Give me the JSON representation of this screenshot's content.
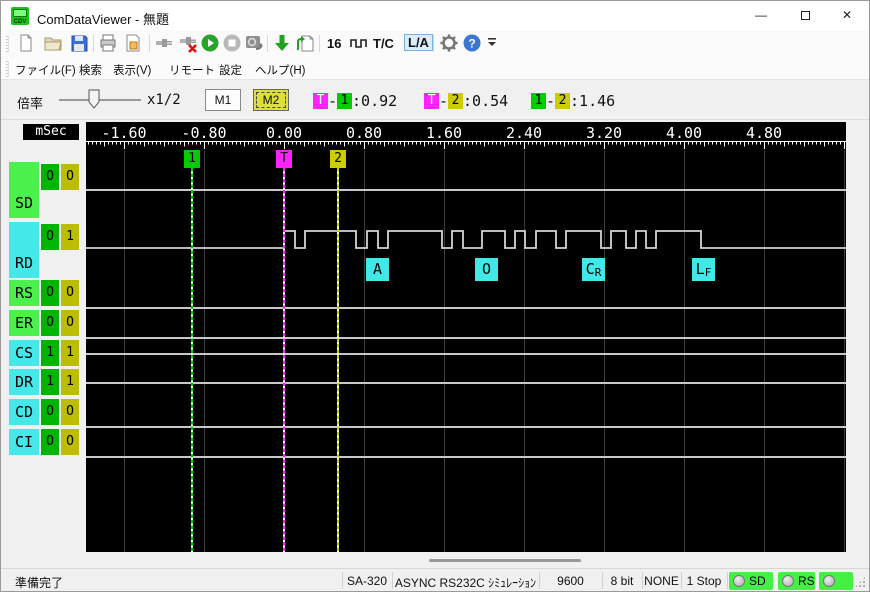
{
  "window": {
    "title": "ComDataViewer - 無題",
    "icon_text": "CDV"
  },
  "toolbar": {
    "icons": [
      "new-file",
      "open-file",
      "save-file",
      "print",
      "print-preview",
      "connect",
      "disconnect",
      "start",
      "stop",
      "capture",
      "download",
      "load-data",
      "gear",
      "help"
    ],
    "text_items": {
      "bits": "16",
      "tc": "T/C",
      "la": "L/A"
    }
  },
  "menu": {
    "items": [
      "ファイル(F)",
      "検索",
      "表示(V)",
      "リモート",
      "設定",
      "ヘルプ(H)"
    ]
  },
  "zoombar": {
    "label": "倍率",
    "scale": "x1/2",
    "m1": "M1",
    "m2": "M2",
    "measurements": [
      {
        "a": "T",
        "a_color": "#ff22ff",
        "a_text": "#fff",
        "b": "1",
        "b_color": "#00cc00",
        "b_text": "#000",
        "value": "0.92"
      },
      {
        "a": "T",
        "a_color": "#ff22ff",
        "a_text": "#fff",
        "b": "2",
        "b_color": "#cccc00",
        "b_text": "#000",
        "value": "0.54"
      },
      {
        "a": "1",
        "a_color": "#00cc00",
        "a_text": "#000",
        "b": "2",
        "b_color": "#cccc00",
        "b_text": "#000",
        "value": "1.46"
      }
    ]
  },
  "ruler": {
    "unit": "mSec",
    "tick_labels": [
      "-1.60",
      "-0.80",
      "0.00",
      "0.80",
      "1.60",
      "2.40",
      "3.20",
      "4.00",
      "4.80"
    ],
    "start_ms": -1.6,
    "step_ms": 0.8
  },
  "markers": [
    {
      "label": "1",
      "ms": -0.92,
      "color": "#00cc00"
    },
    {
      "label": "T",
      "ms": 0.0,
      "color": "#ff22ff"
    },
    {
      "label": "2",
      "ms": 0.54,
      "color": "#cccc00"
    }
  ],
  "channels": [
    {
      "name": "SD",
      "group": "green",
      "values": [
        "O",
        "O"
      ],
      "tall": true,
      "trace": "low"
    },
    {
      "name": "RD",
      "group": "cyan",
      "values": [
        "O",
        "1"
      ],
      "tall": true,
      "trace": "wave"
    },
    {
      "name": "RS",
      "group": "green",
      "values": [
        "O",
        "O"
      ],
      "tall": false,
      "trace": "low"
    },
    {
      "name": "ER",
      "group": "green",
      "values": [
        "O",
        "O"
      ],
      "tall": false,
      "trace": "low"
    },
    {
      "name": "CS",
      "group": "cyan",
      "values": [
        "1",
        "1"
      ],
      "tall": false,
      "trace": "high"
    },
    {
      "name": "DR",
      "group": "cyan",
      "values": [
        "1",
        "1"
      ],
      "tall": false,
      "trace": "high"
    },
    {
      "name": "CD",
      "group": "cyan",
      "values": [
        "O",
        "O"
      ],
      "tall": false,
      "trace": "low"
    },
    {
      "name": "CI",
      "group": "cyan",
      "values": [
        "O",
        "O"
      ],
      "tall": false,
      "trace": "low"
    }
  ],
  "chart_data": {
    "type": "line",
    "title": "RD serial waveform",
    "x_unit": "mSec",
    "rd_transitions_ms": [
      0,
      0.11,
      0.21,
      0.72,
      0.83,
      0.94,
      1.04,
      1.58,
      1.68,
      1.79,
      1.98,
      2.21,
      2.31,
      2.41,
      2.52,
      2.72,
      2.82,
      3.17,
      3.27,
      3.42,
      3.52,
      3.62,
      3.72,
      4.17
    ],
    "rd_initial_level": "low",
    "decoded_chars": [
      {
        "main": "A",
        "sub": "",
        "ms": 0.93
      },
      {
        "main": "O",
        "sub": "",
        "ms": 2.02
      },
      {
        "main": "C",
        "sub": "R",
        "ms": 3.09
      },
      {
        "main": "L",
        "sub": "F",
        "ms": 4.19
      }
    ]
  },
  "statusbar": {
    "ready": "準備完了",
    "items": [
      "SA-320",
      "ASYNC RS232C ｼﾐｭﾚｰｼｮﾝ",
      "9600",
      "8 bit",
      "NONE",
      "1 Stop"
    ],
    "indicators": [
      {
        "label": "SD"
      },
      {
        "label": "RS"
      },
      {
        "label": ""
      }
    ]
  },
  "colors": {
    "green_label": "#4cf04c",
    "cyan_label": "#44e8e8",
    "val1_bg": "#00b400",
    "val2_bg": "#bcbc00",
    "trace": "#c8c8c8",
    "grid": "#3c3c3c"
  }
}
